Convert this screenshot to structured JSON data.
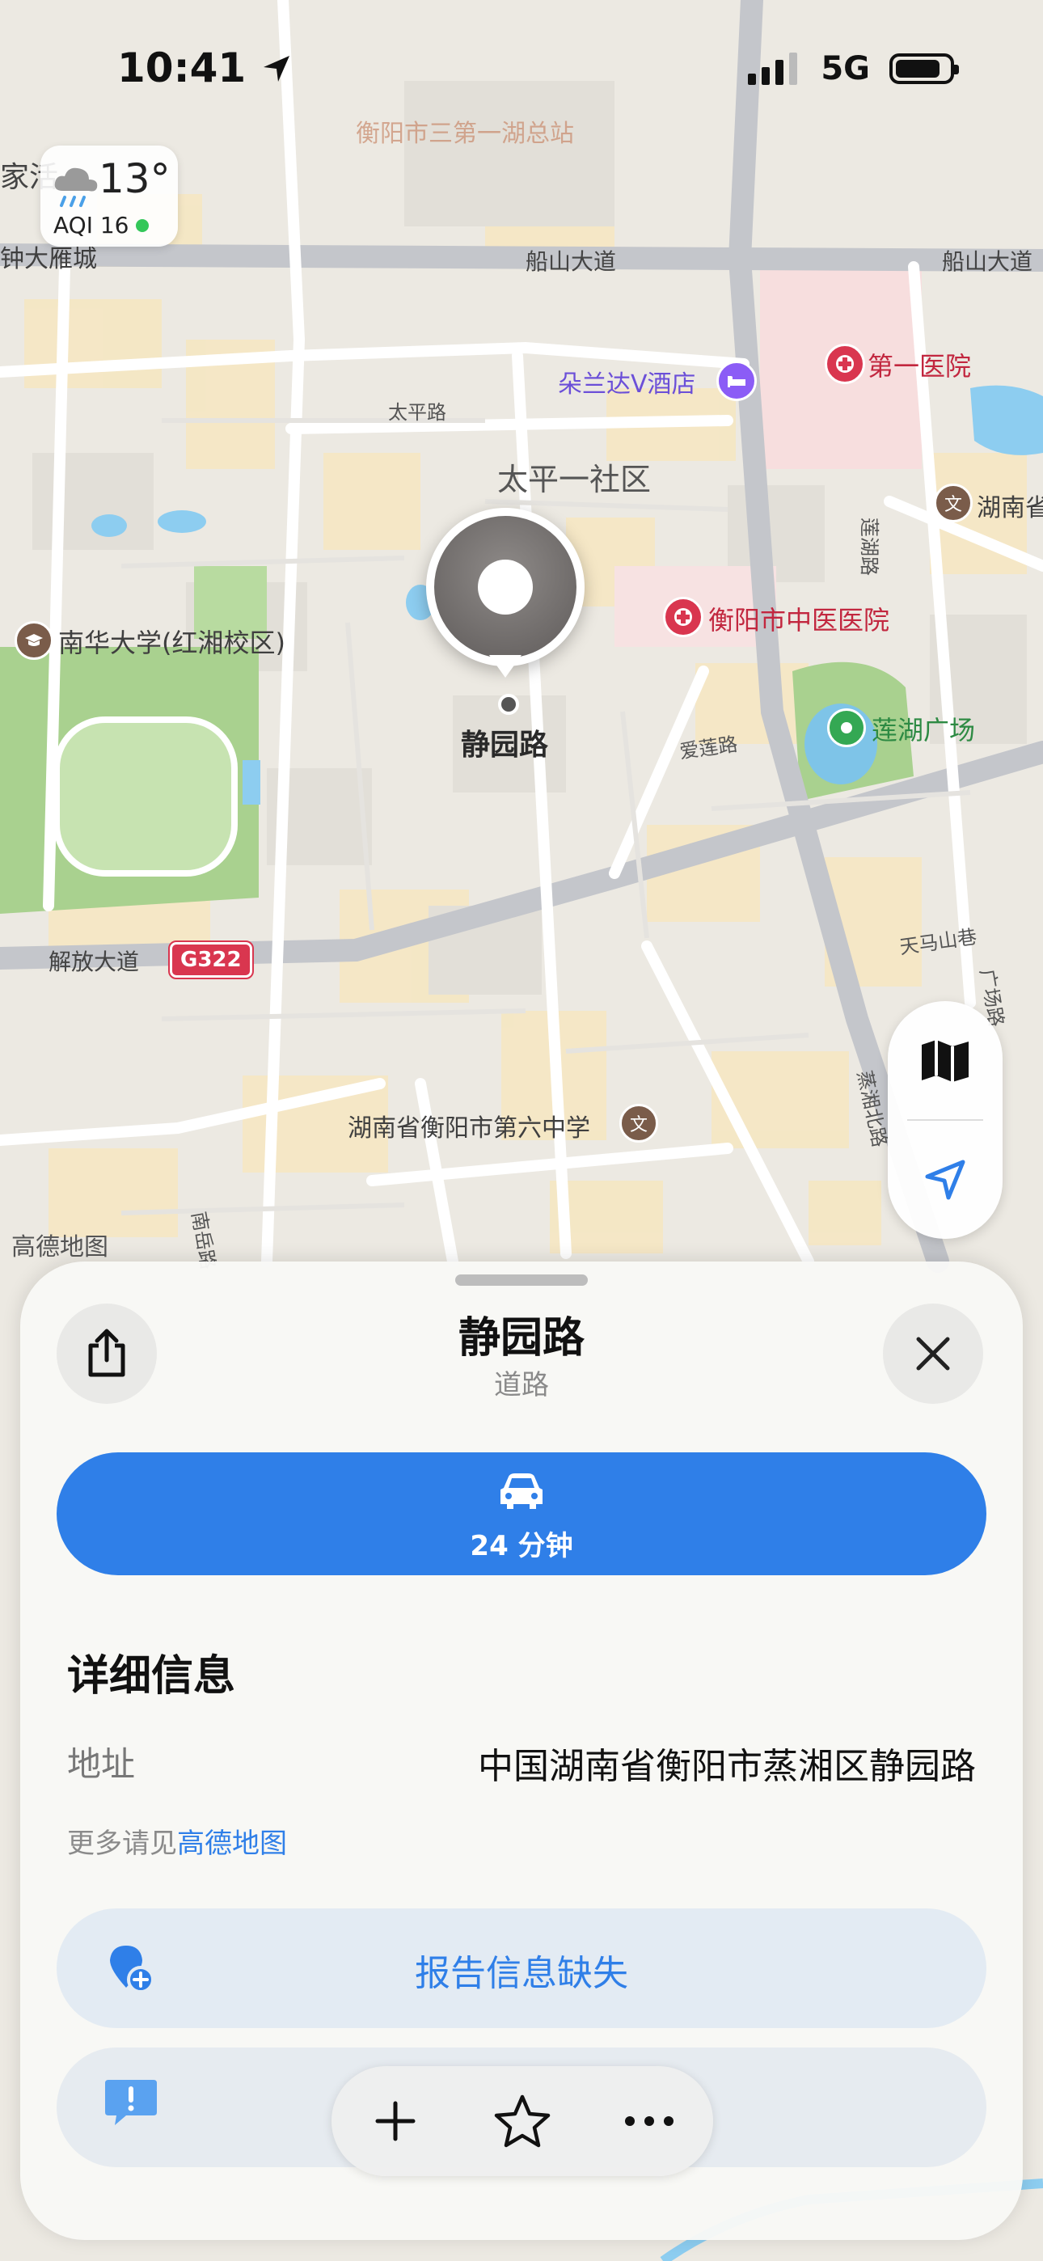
{
  "status_bar": {
    "time": "10:41",
    "network": "5G"
  },
  "weather": {
    "temperature": "13°",
    "aqi": "AQI 16",
    "icon": "rain-cloud-icon"
  },
  "map": {
    "labels": {
      "home_partial": "家活",
      "zhongda": "钟大雁城",
      "chuanshan_1": "船山大道",
      "chuanshan_2": "船山大道",
      "duolanda": "朵兰达V酒店",
      "first_hospital": "第一医院",
      "taiping_road": "太平路",
      "taiping_community": "太平一社区",
      "hunan_partial": "湖南省",
      "nanhua": "南华大学(红湘校区)",
      "tcm_hospital": "衡阳市中医医院",
      "lianhu_square": "莲湖广场",
      "ailian_road": "爱莲路",
      "lianhu_road": "莲湖路",
      "jiefang": "解放大道",
      "g322": "G322",
      "tianma": "天马山巷",
      "guangchang": "广场路",
      "sixth_school": "湖南省衡阳市第六中学",
      "gaode_logo": "高德地图",
      "zhengxiang": "蒸湘北路",
      "nanyue": "南岳路",
      "top_blur": "衡阳市三第一湖总站"
    },
    "pin_label": "静园路"
  },
  "map_controls": {
    "map_mode_icon": "map-icon",
    "locate_icon": "location-arrow-icon"
  },
  "sheet": {
    "title": "静园路",
    "subtitle": "道路",
    "drive_time": "24 分钟",
    "details_heading": "详细信息",
    "address_label": "地址",
    "address_value": "中国湖南省衡阳市蒸湘区静园路",
    "more_prefix": "更多请见",
    "more_link": "高德地图",
    "report_label": "报告信息缺失"
  },
  "colors": {
    "accent": "#2f7fe8",
    "hospital": "#d9364f",
    "park": "#34a853",
    "hotel": "#8b5cf6"
  }
}
